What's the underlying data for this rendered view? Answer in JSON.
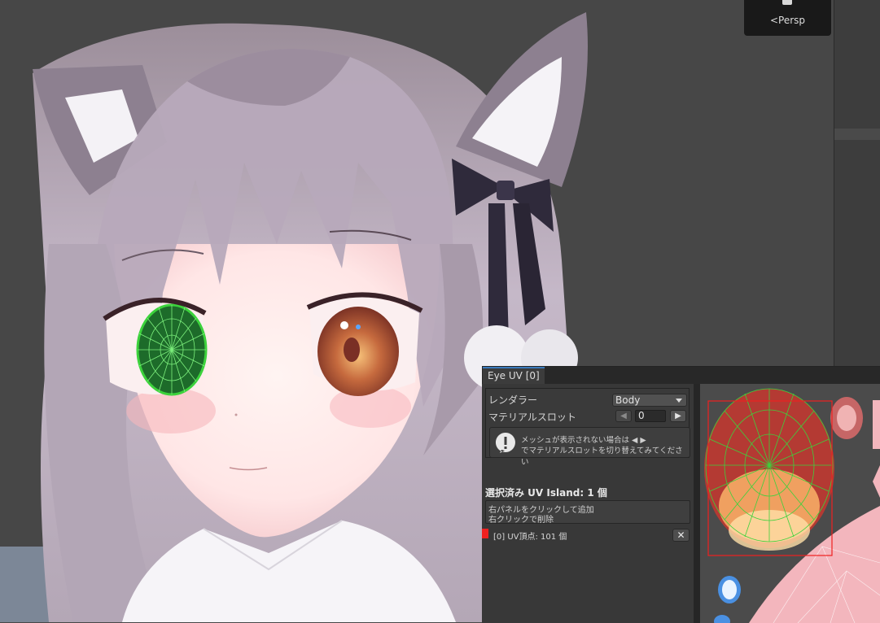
{
  "scene": {
    "view_label": "<Persp"
  },
  "window": {
    "tab_title": "Eye UV [0]",
    "renderer_label": "レンダラー",
    "renderer_value": "Body",
    "material_slot_label": "マテリアルスロット",
    "material_slot_value": "0",
    "help_line1": "メッシュが表示されない場合は ◀ ▶",
    "help_line2": "でマテリアルスロットを切り替えてみてください",
    "selected_heading": "選択済み UV Island: 1 個",
    "hint_line1": "右パネルをクリックして追加",
    "hint_line2": "右クリックで削除",
    "island_item": "[0]  UV頂点: 101 個",
    "close_glyph": "✕",
    "prev_glyph": "◀",
    "next_glyph": "▶"
  },
  "colors": {
    "selection_red": "#f02020",
    "uv_wire_green": "#3cd23c",
    "tab_accent": "#3a79bb"
  },
  "icons": [
    "warning-icon",
    "dropdown-caret-icon",
    "close-icon",
    "arrow-left-icon",
    "arrow-right-icon",
    "view-cube-icon"
  ]
}
